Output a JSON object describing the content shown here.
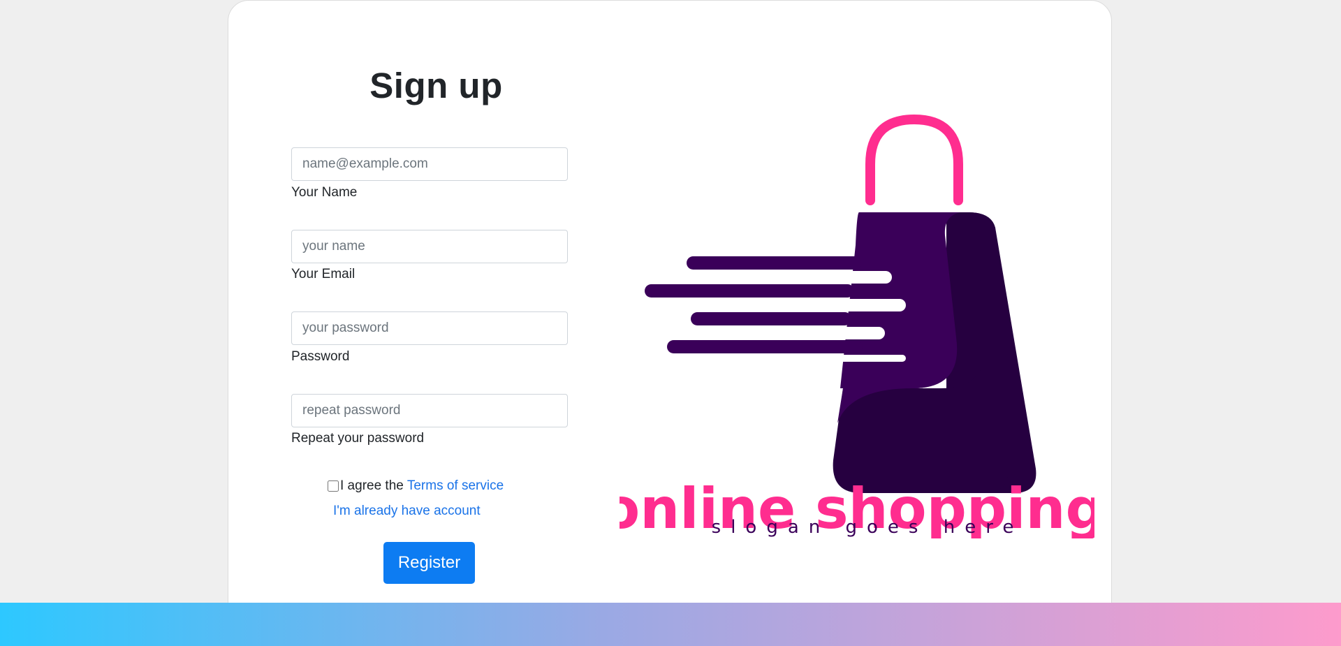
{
  "form": {
    "title": "Sign up",
    "fields": [
      {
        "placeholder": "name@example.com",
        "label": "Your Name"
      },
      {
        "placeholder": "your name",
        "label": "Your Email"
      },
      {
        "placeholder": "your password",
        "label": "Password"
      },
      {
        "placeholder": "repeat password",
        "label": "Repeat your password"
      }
    ],
    "agree_text": "I agree the",
    "terms_link": "Terms of service",
    "login_link": "I'm already have account",
    "register_label": "Register"
  },
  "logo": {
    "brand": "online shopping",
    "slogan": "slogan goes here",
    "colors": {
      "pink": "#ff2d8f",
      "purple": "#3a0059",
      "dark_purple": "#260040"
    }
  },
  "colors": {
    "accent": "#0d7cf2",
    "link": "#1a73e8"
  }
}
